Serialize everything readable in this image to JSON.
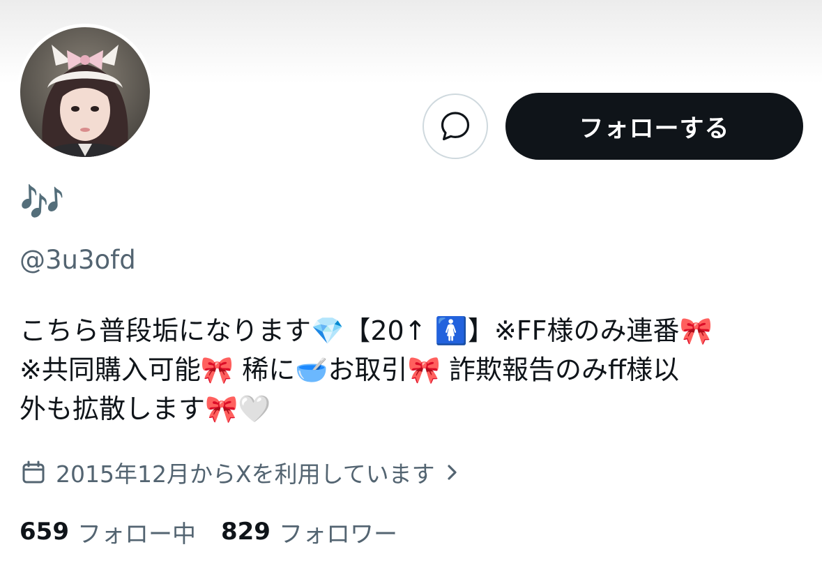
{
  "profile": {
    "display_name": "🎶",
    "handle": "@3u3ofd",
    "avatar_icon": "profile-photo",
    "bio_lines": [
      "こちら普段垢になります💎【20↑ 🚺】※FF様のみ連番🎀",
      "※共同購入可能🎀 稀に🥣お取引🎀 詐欺報告のみff様以",
      "外も拡散します🎀🤍"
    ],
    "joined_text": "2015年12月からXを利用しています",
    "following": {
      "count": "659",
      "label": "フォロー中"
    },
    "followers": {
      "count": "829",
      "label": "フォロワー"
    }
  },
  "actions": {
    "follow_label": "フォローする",
    "message_icon": "message-bubble-icon"
  },
  "icons": {
    "calendar": "calendar-icon",
    "chevron": "chevron-right-icon"
  },
  "colors": {
    "primary_text": "#0f1419",
    "secondary_text": "#536471",
    "follow_button_bg": "#0f1419",
    "follow_button_text": "#ffffff",
    "border": "#cfd9de"
  }
}
